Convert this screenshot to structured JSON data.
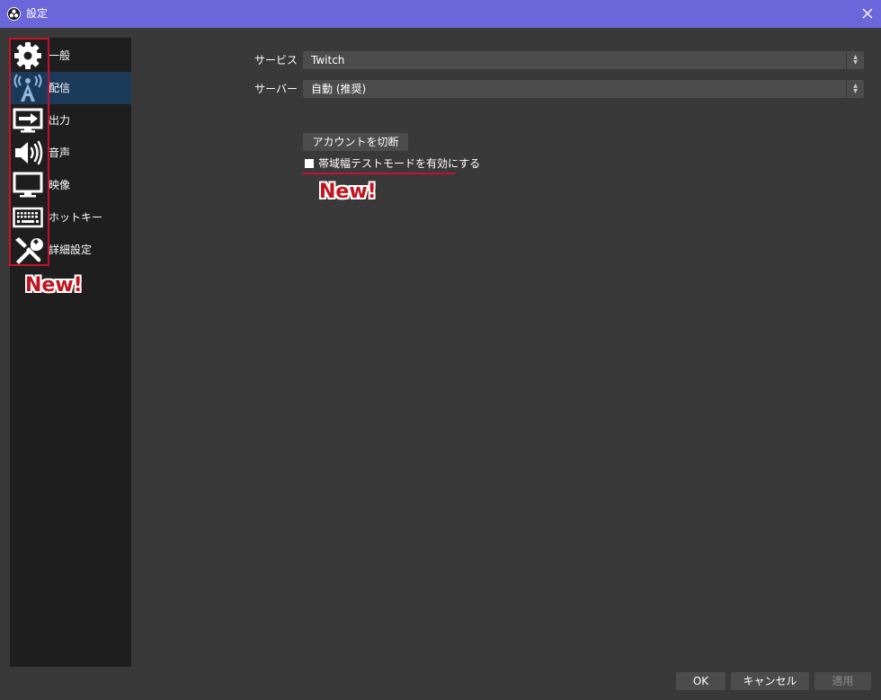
{
  "window": {
    "title": "設定",
    "close_label": "✕"
  },
  "sidebar": {
    "items": [
      {
        "label": "一般",
        "icon": "gear-icon"
      },
      {
        "label": "配信",
        "icon": "broadcast-antenna-icon"
      },
      {
        "label": "出力",
        "icon": "output-monitor-icon"
      },
      {
        "label": "音声",
        "icon": "speaker-icon"
      },
      {
        "label": "映像",
        "icon": "monitor-icon"
      },
      {
        "label": "ホットキー",
        "icon": "keyboard-icon"
      },
      {
        "label": "詳細設定",
        "icon": "wrench-screwdriver-icon"
      }
    ],
    "selected_index": 1
  },
  "stream": {
    "service_label": "サービス",
    "service_value": "Twitch",
    "server_label": "サーバー",
    "server_value": "自動 (推奨)",
    "disconnect_button": "アカウントを切断",
    "bandwidth_test_label": "帯域幅テストモードを有効にする",
    "bandwidth_test_checked": false
  },
  "annotations": {
    "new_badge_1": "New!",
    "new_badge_2": "New!",
    "highlight_color": "#c8102e"
  },
  "footer": {
    "ok": "OK",
    "cancel": "キャンセル",
    "apply": "適用"
  },
  "colors": {
    "titlebar": "#6b67db",
    "background": "#3a393a",
    "sidebar": "#1f1e1f",
    "selected": "#1b3a5a",
    "control": "#4c4c4c"
  }
}
